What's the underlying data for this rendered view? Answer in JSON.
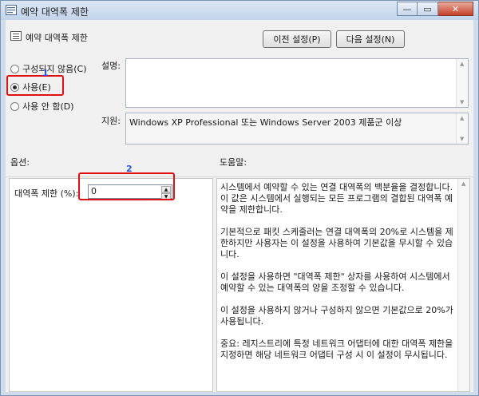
{
  "window": {
    "title": "예약 대역폭 제한",
    "minimize_glyph": "—",
    "maximize_glyph": "▭",
    "close_glyph": "✕"
  },
  "policy": {
    "title": "예약 대역폭 제한",
    "prev_button": "이전 설정(P)",
    "next_button": "다음 설정(N)"
  },
  "state": {
    "not_configured": "구성되지 않음(C)",
    "enabled": "사용(E)",
    "disabled": "사용 안 함(D)",
    "selected": "enabled"
  },
  "comment": {
    "label": "설명:",
    "value": ""
  },
  "supported": {
    "label": "지원:",
    "value": "Windows XP Professional 또는 Windows Server 2003 제품군 이상"
  },
  "options": {
    "header": "옵션:",
    "bandwidth_label": "대역폭 제한 (%):",
    "bandwidth_value": "0"
  },
  "help": {
    "header": "도움말:",
    "paragraphs": [
      "시스템에서 예약할 수 있는 연결 대역폭의 백분율을 결정합니다. 이 값은 시스템에서 실행되는 모든 프로그램의 결합된 대역폭 예약을 제한합니다.",
      "기본적으로 패킷 스케줄러는 연결 대역폭의 20%로 시스템을 제한하지만 사용자는 이 설정을 사용하여 기본값을 무시할 수 있습니다.",
      "이 설정을 사용하면 \"대역폭 제한\" 상자를 사용하여 시스템에서 예약할 수 있는 대역폭의 양을 조정할 수 있습니다.",
      "이 설정을 사용하지 않거나 구성하지 않으면 기본값으로 20%가 사용됩니다.",
      "중요: 레지스트리에 특정 네트워크 어댑터에 대한 대역폭 제한을 지정하면 해당 네트워크 어댑터 구성 시 이 설정이 무시됩니다."
    ]
  },
  "annotations": {
    "marker1": "1",
    "marker2": "2"
  },
  "colors": {
    "highlight": "#e01010",
    "marker": "#2a55d6"
  }
}
